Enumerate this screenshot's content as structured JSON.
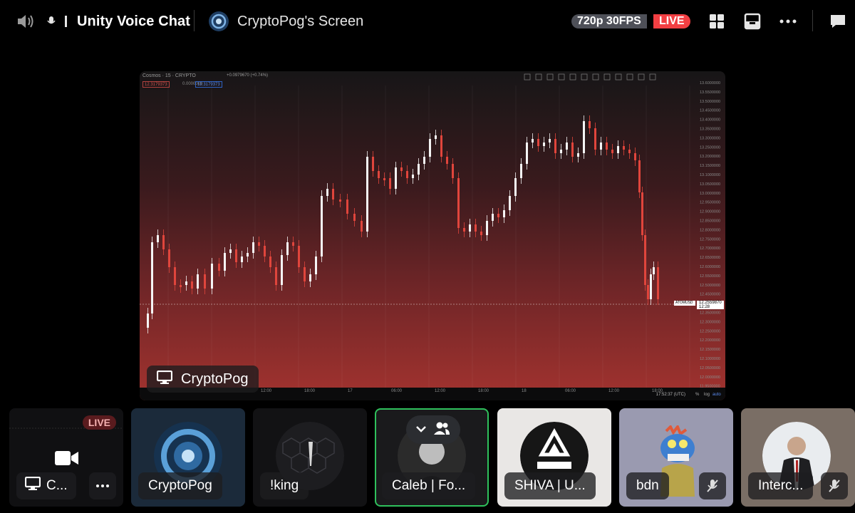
{
  "window": {
    "channel_name": "Unity Voice Chat",
    "screen_title": "CryptoPog's Screen",
    "quality": "720p 30FPS",
    "live": "LIVE"
  },
  "icons": {
    "voice": "speaker-icon",
    "grid": "grid-layout-icon",
    "popout": "popout-icon",
    "more": "more-icon",
    "chat": "chat-icon"
  },
  "stream": {
    "streamer": "CryptoPog",
    "chart_header": "Cosmos · 15 · CRYPTO",
    "chart_change": "+0.0979670 (+0.74%)",
    "box_a": "12.3179373",
    "box_b": "0.0000000",
    "box_c": "12.3179373",
    "symbol": "ATOMUSD",
    "last_price": "12.2559870",
    "last_time": "12:28",
    "utc_time": "17:52:37 (UTC)",
    "watermark": "TradingView",
    "time_labels": [
      "12:00",
      "18:00",
      "17",
      "06:00",
      "12:00",
      "18:00",
      "18",
      "06:00",
      "12:00",
      "18:00"
    ],
    "price_labels": [
      "13.6000000",
      "13.5500000",
      "13.5000000",
      "13.4500000",
      "13.4000000",
      "13.3500000",
      "13.3000000",
      "13.2500000",
      "13.2000000",
      "13.1500000",
      "13.1000000",
      "13.0500000",
      "13.0000000",
      "12.9500000",
      "12.9000000",
      "12.8500000",
      "12.8000000",
      "12.7500000",
      "12.7000000",
      "12.6500000",
      "12.6000000",
      "12.5500000",
      "12.5000000",
      "12.4500000",
      "12.4000000",
      "12.3500000",
      "12.3000000",
      "12.2500000",
      "12.2000000",
      "12.1500000",
      "12.1000000",
      "12.0500000",
      "12.0000000",
      "11.9500000"
    ],
    "bottom_controls": [
      "%",
      "log",
      "auto"
    ]
  },
  "participants": [
    {
      "label": "C...",
      "live": "LIVE",
      "type": "screen"
    },
    {
      "label": "CryptoPog",
      "type": "avatar"
    },
    {
      "label": "!king",
      "type": "avatar"
    },
    {
      "label": "Caleb | Fo...",
      "type": "avatar",
      "active": true
    },
    {
      "label": "SHIVA | U...",
      "type": "avatar"
    },
    {
      "label": "bdn",
      "type": "avatar",
      "muted": true
    },
    {
      "label": "Interc...",
      "type": "avatar",
      "muted": true
    }
  ],
  "colors": {
    "live_red": "#f23f43",
    "speaking_green": "#2fc15c",
    "badge_gray": "#4e5058"
  }
}
